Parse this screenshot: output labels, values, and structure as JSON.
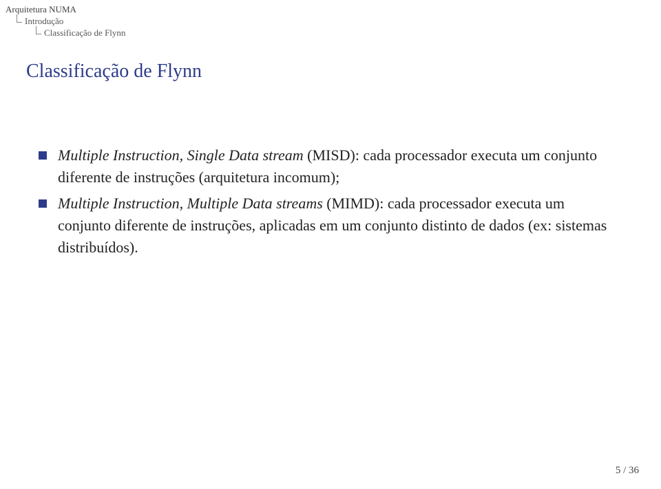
{
  "breadcrumb": {
    "level1": "Arquitetura NUMA",
    "level2": "Introdução",
    "level3": "Classificação de Flynn"
  },
  "title": "Classificação de Flynn",
  "bullets": [
    {
      "italic": "Multiple Instruction, Single Data stream",
      "rest": " (MISD): cada processador executa um conjunto diferente de instruções (arquitetura incomum);"
    },
    {
      "italic": "Multiple Instruction, Multiple Data streams",
      "rest": " (MIMD): cada processador executa um conjunto diferente de instruções, aplicadas em um conjunto distinto de dados (ex: sistemas distribuídos)."
    }
  ],
  "pageNumber": "5 / 36"
}
